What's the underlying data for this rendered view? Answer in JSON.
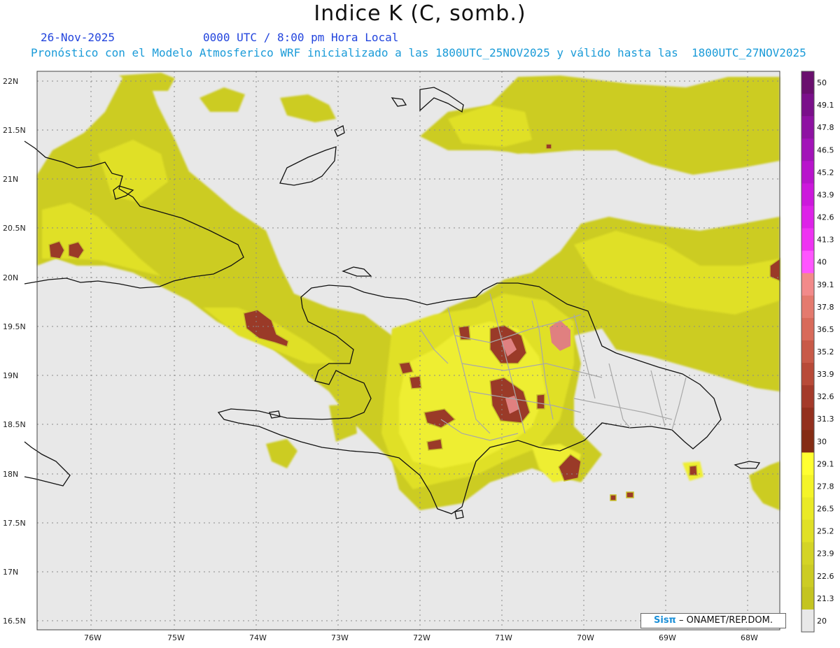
{
  "title": "Indice K (C, somb.)",
  "date": "26-Nov-2025",
  "time": "0000 UTC / 8:00 pm Hora Local",
  "forecast_line": "Pronóstico con el Modelo Atmosferico WRF inicializado a las 1800UTC_25NOV2025 y válido hasta las  1800UTC_27NOV2025",
  "credit": {
    "sis": "Sisπ",
    "rest": " – ONAMET/REP.DOM."
  },
  "map": {
    "lat_labels": [
      "22N",
      "21.5N",
      "21N",
      "20.5N",
      "20N",
      "19.5N",
      "19N",
      "18.5N",
      "18N",
      "17.5N",
      "17N",
      "16.5N"
    ],
    "lon_labels": [
      "76W",
      "75W",
      "74W",
      "73W",
      "72W",
      "71W",
      "70W",
      "69W",
      "68W"
    ]
  },
  "colorbar": {
    "labels": [
      "50",
      "49.1",
      "47.8",
      "46.5",
      "45.2",
      "43.9",
      "42.6",
      "41.3",
      "40",
      "39.1",
      "37.8",
      "36.5",
      "35.2",
      "33.9",
      "32.6",
      "31.3",
      "30",
      "29.1",
      "27.8",
      "26.5",
      "25.2",
      "23.9",
      "22.6",
      "21.3",
      "20"
    ],
    "colors": [
      "#6a0f6e",
      "#7a108a",
      "#8e12a2",
      "#a213b8",
      "#b814cc",
      "#cc18dc",
      "#dd22e8",
      "#ee33f2",
      "#ff55ff",
      "#f28a8a",
      "#e47a6e",
      "#d86a5a",
      "#c85a48",
      "#b84a38",
      "#a43a2a",
      "#93301e",
      "#842c14",
      "#ffff30",
      "#f4f428",
      "#eaea26",
      "#e0e026",
      "#d4d426",
      "#cccc24",
      "#c4c421",
      "#e8e8e8"
    ]
  }
}
